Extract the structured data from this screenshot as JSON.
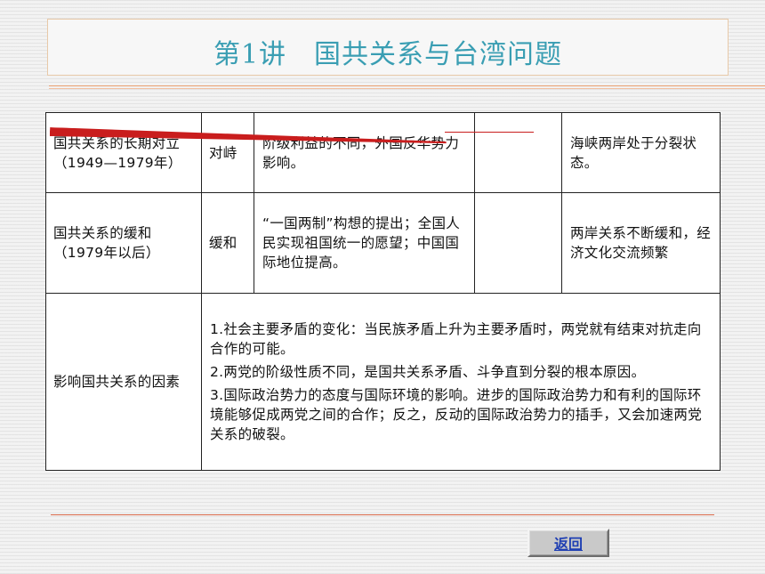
{
  "title": "第1讲　国共关系与台湾问题",
  "table": {
    "rows": [
      {
        "topic": "国共关系的长期对立（1949—1979年）",
        "characteristic": "对峙",
        "reason": "阶级利益的不同，外国反华势力影响。",
        "empty": "",
        "result": "海峡两岸处于分裂状态。"
      },
      {
        "topic": "国共关系的缓和（1979年以后）",
        "characteristic": "缓和",
        "reason": "“一国两制”构想的提出；全国人民实现祖国统一的愿望；中国国际地位提高。",
        "empty": "",
        "result": "两岸关系不断缓和，经济文化交流频繁"
      }
    ],
    "factors_label": "影响国共关系的因素",
    "factors": [
      "1.社会主要矛盾的变化：当民族矛盾上升为主要矛盾时，两党就有结束对抗走向合作的可能。",
      "2.两党的阶级性质不同，是国共关系矛盾、斗争直到分裂的根本原因。",
      "3.国际政治势力的态度与国际环境的影响。进步的国际政治势力和有利的国际环境能够促成两党之间的合作；反之，反动的国际政治势力的插手，又会加速两党关系的破裂。"
    ]
  },
  "back_button": "返回",
  "colors": {
    "title": "#3a9eb3",
    "annotation_red": "#c91d1d",
    "button_text": "#1f3fb3"
  }
}
